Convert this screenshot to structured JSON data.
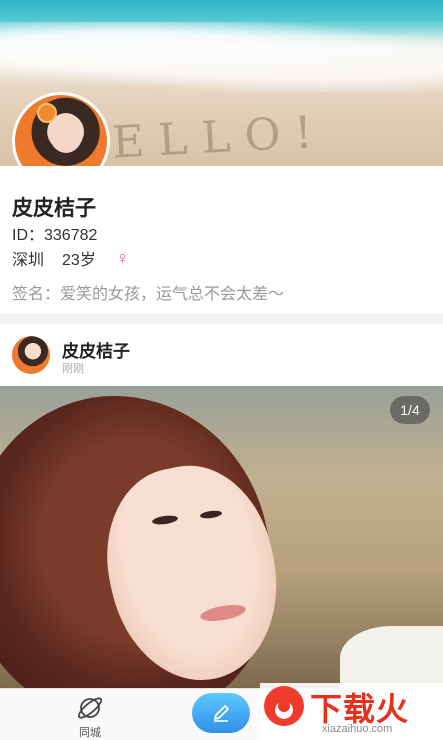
{
  "profile": {
    "nickname": "皮皮桔子",
    "id_text": "ID：336782",
    "city": "深圳",
    "age": "23岁",
    "gender_symbol": "♀",
    "signature": "签名：爱笑的女孩，运气总不会太差～",
    "cover_sand_text": "ELLO!"
  },
  "post": {
    "author": "皮皮桔子",
    "time": "刚刚",
    "page_indicator": "1/4"
  },
  "tabbar": {
    "city_label": "同城",
    "city_icon": "planet-icon",
    "compose_icon": "pencil-icon"
  },
  "watermark": {
    "title": "下载火",
    "url": "xiazaihuo.com"
  },
  "colors": {
    "accent_blue": "#2f8fe8",
    "gender_pink": "#e85aa6",
    "watermark_red": "#e8301f"
  }
}
